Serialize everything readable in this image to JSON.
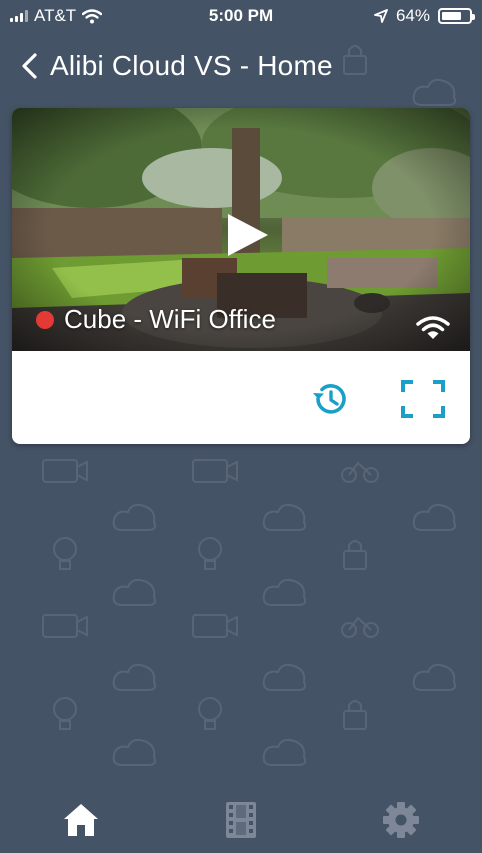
{
  "status_bar": {
    "carrier": "AT&T",
    "time": "5:00 PM",
    "battery": "64%",
    "icons": [
      "signal-icon",
      "wifi-icon",
      "location-icon",
      "battery-icon"
    ]
  },
  "header": {
    "title": "Alibi Cloud VS - Home",
    "back_icon": "chevron-left-icon"
  },
  "camera_card": {
    "name": "Cube - WiFi Office",
    "status_color": "#e53935",
    "connection_icon": "wifi-icon",
    "actions": [
      "history-icon",
      "fullscreen-icon"
    ]
  },
  "bottom_nav": {
    "items": [
      "home-icon",
      "film-icon",
      "gear-icon"
    ],
    "active": "home-icon"
  },
  "colors": {
    "background": "#455366",
    "accent": "#1aa0c8",
    "active_nav": "#ffffff",
    "inactive_nav": "#7d8797"
  }
}
